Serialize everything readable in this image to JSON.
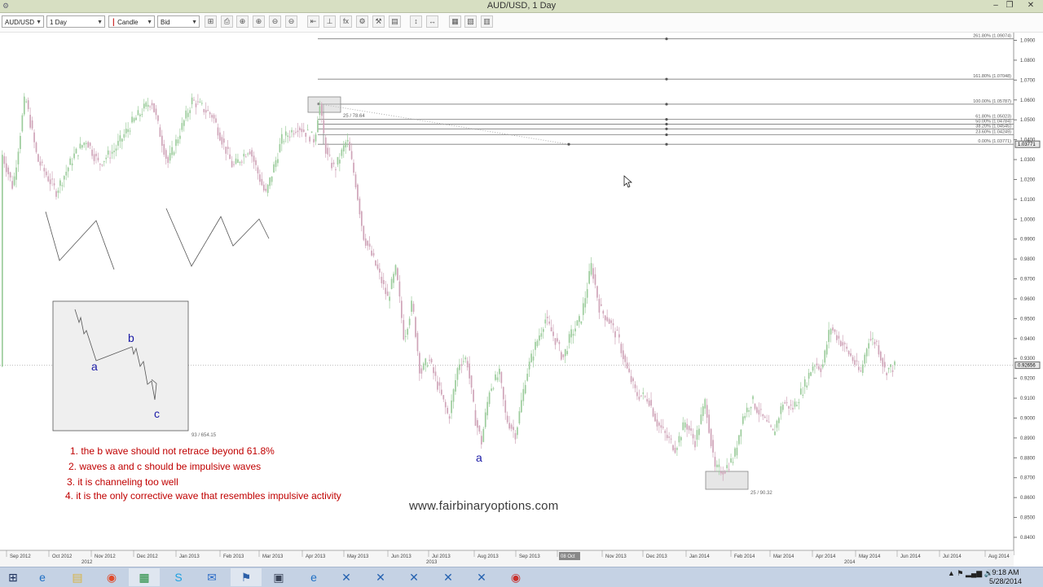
{
  "window": {
    "title": "AUD/USD,  1 Day",
    "minimize": "–",
    "restore": "❐",
    "close": "✕"
  },
  "toolbar": {
    "symbol": "AUD/USD",
    "period": "1 Day",
    "chart_type": "Candle",
    "price_type": "Bid",
    "buttons": [
      "⊞",
      "⎙",
      "⊕",
      "⊕",
      "⊖",
      "⊖",
      "⇤",
      "⊥",
      "fx",
      "⚙",
      "⚒",
      "▤",
      "↕",
      "↔",
      "▦",
      "▧",
      "▥"
    ]
  },
  "chart_data": {
    "type": "candlestick",
    "instrument": "AUD/USD",
    "period": "1 Day",
    "y_axis": {
      "ticks": [
        "1.0900",
        "1.0800",
        "1.0700",
        "1.0600",
        "1.0500",
        "1.0400",
        "1.0300",
        "1.0200",
        "1.0100",
        "1.0000",
        "0.9900",
        "0.9800",
        "0.9700",
        "0.9600",
        "0.9500",
        "0.9400",
        "0.9300",
        "0.9200",
        "0.9100",
        "0.9000",
        "0.8900",
        "0.8800",
        "0.8700",
        "0.8600",
        "0.8500",
        "0.8400"
      ],
      "current_price": "0.92656",
      "marker_price": "1.03771"
    },
    "x_axis": {
      "months": [
        "Sep 2012",
        "Oct 2012",
        "Nov 2012",
        "Dec 2012",
        "Jan 2013",
        "Feb 2013",
        "Mar 2013",
        "Apr 2013",
        "May 2013",
        "Jun 2013",
        "Jul 2013",
        "Aug 2013",
        "Sep 2013",
        "08 Oct",
        "Nov 2013",
        "Dec 2013",
        "Jan 2014",
        "Feb 2014",
        "Mar 2014",
        "Apr 2014",
        "May 2014",
        "Jun 2014",
        "Jul 2014",
        "Aug 2014"
      ],
      "years": [
        "2012",
        "2013",
        "2014"
      ]
    },
    "fibonacci": [
      {
        "label": "261.80% (1.09074)",
        "price": 1.09074
      },
      {
        "label": "161.80% (1.07048)",
        "price": 1.07048
      },
      {
        "label": "100.00% (1.05787)",
        "price": 1.05787
      },
      {
        "label": "61.80% (1.05023)",
        "price": 1.05023
      },
      {
        "label": "50.00% (1.04784)",
        "price": 1.04784
      },
      {
        "label": "38.20% (1.04545)",
        "price": 1.04545
      },
      {
        "label": "23.60% (1.04249)",
        "price": 1.04249
      },
      {
        "label": "0.00% (1.03771)",
        "price": 1.03771
      }
    ],
    "path": [
      [
        0,
        1.035
      ],
      [
        15,
        1.016
      ],
      [
        30,
        1.062
      ],
      [
        45,
        1.03
      ],
      [
        68,
        1.014
      ],
      [
        90,
        1.032
      ],
      [
        105,
        1.04
      ],
      [
        120,
        1.028
      ],
      [
        140,
        1.035
      ],
      [
        160,
        1.048
      ],
      [
        185,
        1.06
      ],
      [
        205,
        1.028
      ],
      [
        235,
        1.06
      ],
      [
        260,
        1.052
      ],
      [
        285,
        1.026
      ],
      [
        305,
        1.036
      ],
      [
        325,
        1.012
      ],
      [
        345,
        1.04
      ],
      [
        365,
        1.047
      ],
      [
        385,
        1.04
      ],
      [
        391,
        1.058
      ],
      [
        400,
        1.032
      ],
      [
        410,
        1.025
      ],
      [
        425,
        1.04
      ],
      [
        435,
        1.02
      ],
      [
        445,
        0.992
      ],
      [
        455,
        0.982
      ],
      [
        462,
        0.975
      ],
      [
        475,
        0.96
      ],
      [
        485,
        0.975
      ],
      [
        495,
        0.94
      ],
      [
        505,
        0.958
      ],
      [
        515,
        0.922
      ],
      [
        525,
        0.93
      ],
      [
        535,
        0.918
      ],
      [
        550,
        0.9
      ],
      [
        562,
        0.928
      ],
      [
        572,
        0.93
      ],
      [
        582,
        0.9
      ],
      [
        590,
        0.888
      ],
      [
        600,
        0.915
      ],
      [
        612,
        0.922
      ],
      [
        620,
        0.9
      ],
      [
        632,
        0.892
      ],
      [
        645,
        0.922
      ],
      [
        655,
        0.935
      ],
      [
        668,
        0.95
      ],
      [
        680,
        0.94
      ],
      [
        690,
        0.93
      ],
      [
        700,
        0.942
      ],
      [
        712,
        0.95
      ],
      [
        725,
        0.977
      ],
      [
        735,
        0.955
      ],
      [
        745,
        0.95
      ],
      [
        758,
        0.94
      ],
      [
        768,
        0.925
      ],
      [
        780,
        0.912
      ],
      [
        795,
        0.91
      ],
      [
        805,
        0.898
      ],
      [
        818,
        0.89
      ],
      [
        828,
        0.885
      ],
      [
        840,
        0.898
      ],
      [
        852,
        0.888
      ],
      [
        865,
        0.909
      ],
      [
        876,
        0.874
      ],
      [
        888,
        0.874
      ],
      [
        900,
        0.88
      ],
      [
        910,
        0.9
      ],
      [
        922,
        0.909
      ],
      [
        935,
        0.9
      ],
      [
        948,
        0.892
      ],
      [
        960,
        0.908
      ],
      [
        972,
        0.905
      ],
      [
        985,
        0.915
      ],
      [
        998,
        0.928
      ],
      [
        1008,
        0.925
      ],
      [
        1018,
        0.946
      ],
      [
        1030,
        0.939
      ],
      [
        1045,
        0.93
      ],
      [
        1055,
        0.922
      ],
      [
        1065,
        0.94
      ],
      [
        1075,
        0.938
      ],
      [
        1085,
        0.924
      ],
      [
        1098,
        0.926
      ]
    ]
  },
  "annotations": {
    "notes": [
      "1. the b wave should not retrace beyond 61.8%",
      "2. waves a and c should be impulsive waves",
      "3. it is channeling too well",
      "4. it is the only corrective wave that resembles impulsive activity"
    ],
    "watermark": "www.fairbinaryoptions.com",
    "wave_a_main": "a",
    "inset_a": "a",
    "inset_b": "b",
    "inset_c": "c",
    "small_label_1": "25 / 78.64",
    "small_label_2": "93 / 654.15",
    "small_label_3": "25 / 90.32"
  },
  "taskbar": {
    "items": [
      "⊞",
      "e",
      "▤",
      "◉",
      "▦",
      "S",
      "✉",
      "⚑",
      "▣",
      "e",
      "✕",
      "✕",
      "✕",
      "✕",
      "✕",
      "◉"
    ],
    "time": "9:18 AM",
    "date": "5/28/2014",
    "tray": "▲  ⚑  ▂▄▆  🔊"
  },
  "colors": {
    "bull": "#9ccc9c",
    "bear": "#cfa4b8",
    "fib": "#808080",
    "annotation": "#c00000",
    "wave_label": "#1a1aa6"
  }
}
